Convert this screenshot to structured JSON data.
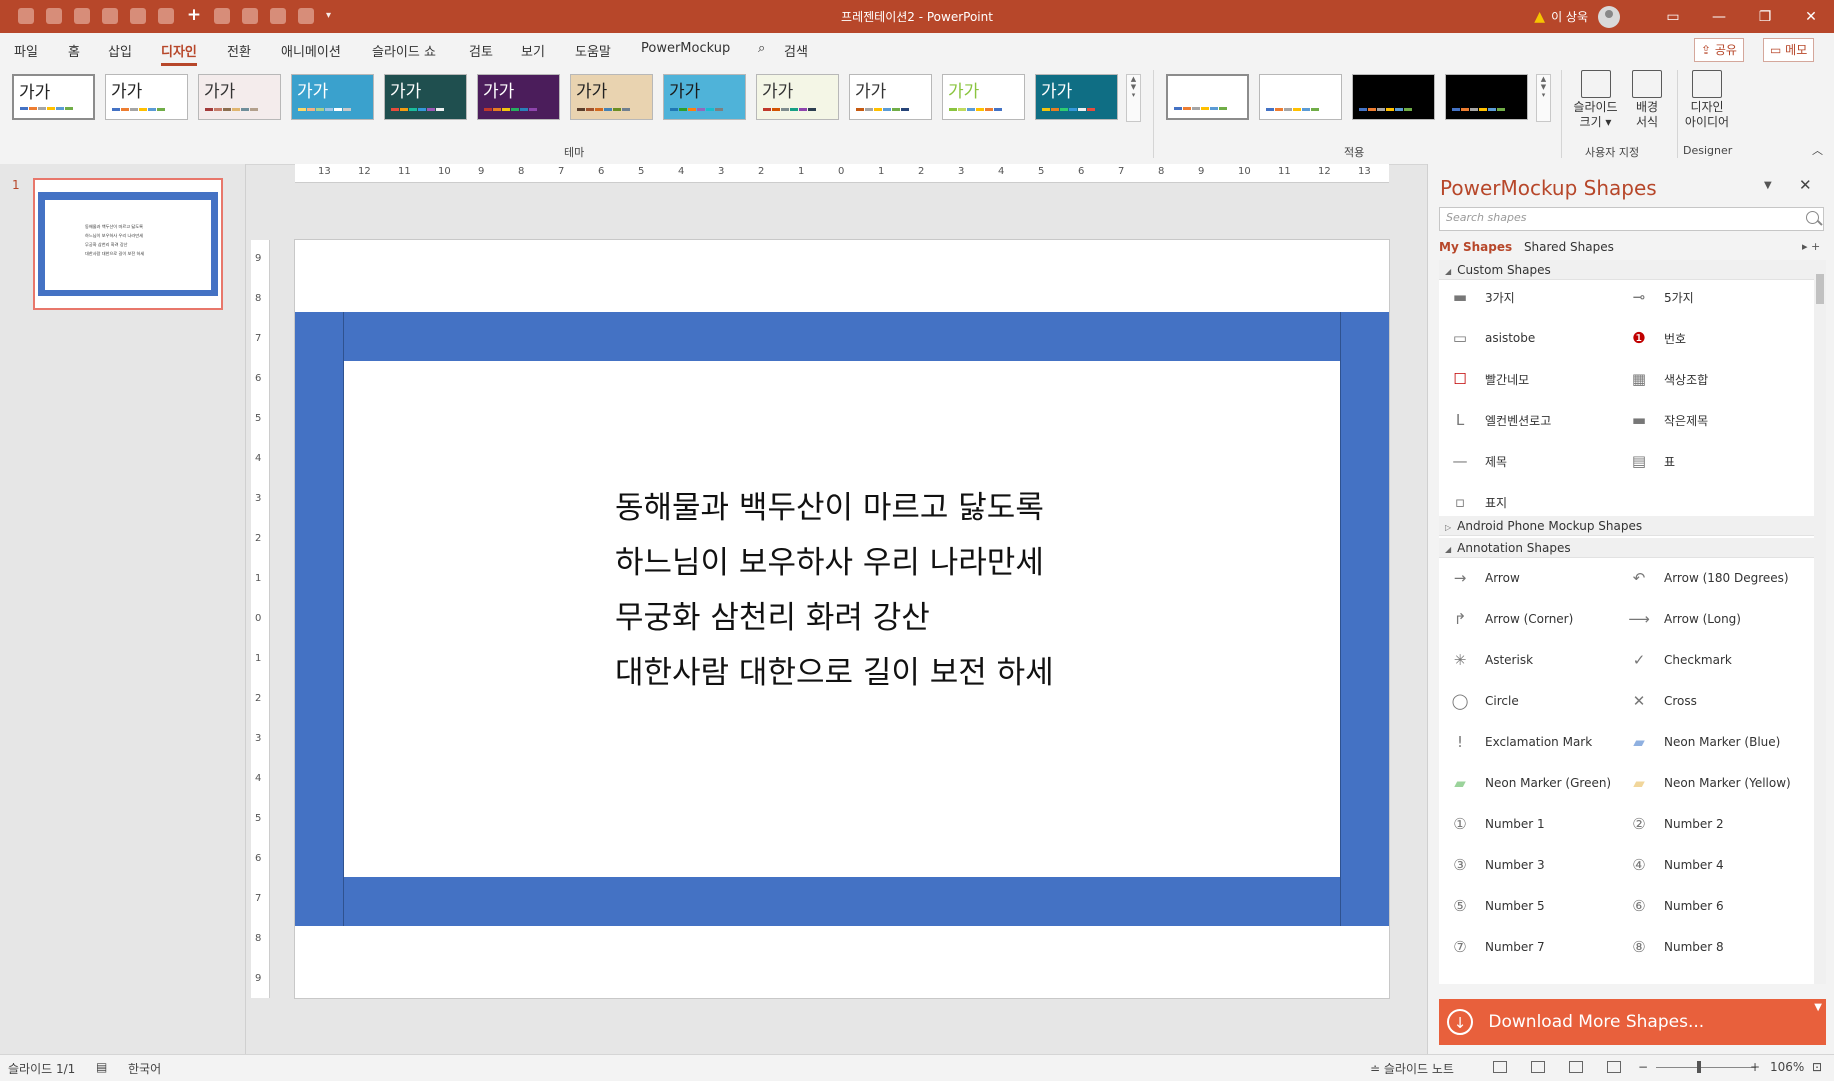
{
  "window": {
    "title": "프레젠테이션2  -  PowerPoint",
    "user": "이 상욱"
  },
  "menu": [
    "파일",
    "홈",
    "삽입",
    "디자인",
    "전환",
    "애니메이션",
    "슬라이드 쇼",
    "검토",
    "보기",
    "도움말",
    "PowerMockup"
  ],
  "menu_active": "디자인",
  "search_label": "검색",
  "share_label": "공유",
  "memo_label": "메모",
  "themes": {
    "sample_text": "가가",
    "items": [
      {
        "bg": "#ffffff",
        "fg": "#222222",
        "bars": [
          "#4472c4",
          "#ed7d31",
          "#a5a5a5",
          "#ffc000",
          "#5b9bd5",
          "#70ad47"
        ]
      },
      {
        "bg": "#ffffff",
        "fg": "#222222",
        "bars": [
          "#4472c4",
          "#ed7d31",
          "#a5a5a5",
          "#ffc000",
          "#5b9bd5",
          "#70ad47"
        ]
      },
      {
        "bg": "#f4ecec",
        "fg": "#333333",
        "bars": [
          "#a33a3a",
          "#c67c6a",
          "#8c6e4f",
          "#e0b56f",
          "#6f8e9a",
          "#b3a08c"
        ]
      },
      {
        "bg": "#3aa1cd",
        "fg": "#ffffff",
        "bars": [
          "#ffd966",
          "#f4b183",
          "#a9d18e",
          "#9dc3e6",
          "#ffffff",
          "#c9c9c9"
        ]
      },
      {
        "bg": "#1f4f4f",
        "fg": "#ffffff",
        "bars": [
          "#e74c3c",
          "#f39c12",
          "#1abc9c",
          "#3498db",
          "#9b59b6",
          "#ecf0f1"
        ]
      },
      {
        "bg": "#4b1d5b",
        "fg": "#ffffff",
        "bars": [
          "#c0392b",
          "#e67e22",
          "#f1c40f",
          "#27ae60",
          "#2980b9",
          "#8e44ad"
        ]
      },
      {
        "bg": "#e9d3b0",
        "fg": "#222222",
        "bars": [
          "#5a3e2b",
          "#a0522d",
          "#d2691e",
          "#4682b4",
          "#6b8e23",
          "#708090"
        ]
      },
      {
        "bg": "#4fb3d9",
        "fg": "#1a1a1a",
        "bars": [
          "#1f77b4",
          "#2ca02c",
          "#ff7f0e",
          "#9467bd",
          "#17becf",
          "#7f7f7f"
        ]
      },
      {
        "bg": "#f4f6e6",
        "fg": "#333333",
        "bars": [
          "#c0392b",
          "#d35400",
          "#7f8c8d",
          "#16a085",
          "#8e44ad",
          "#2c3e50"
        ]
      },
      {
        "bg": "#ffffff",
        "fg": "#333333",
        "bars": [
          "#c55a11",
          "#a5a5a5",
          "#ffc000",
          "#5b9bd5",
          "#70ad47",
          "#264478"
        ]
      },
      {
        "bg": "#ffffff",
        "fg": "#8ac43f",
        "bars": [
          "#8ac43f",
          "#c0db60",
          "#5b9bd5",
          "#ffc000",
          "#ed7d31",
          "#4472c4"
        ]
      },
      {
        "bg": "#0f6e84",
        "fg": "#ffffff",
        "bars": [
          "#f1c40f",
          "#e67e22",
          "#2ecc71",
          "#3498db",
          "#ecf0f1",
          "#e74c3c"
        ]
      }
    ],
    "variants": [
      {
        "bg": "#ffffff",
        "bars": [
          "#4472c4",
          "#ed7d31",
          "#a5a5a5",
          "#ffc000",
          "#5b9bd5",
          "#70ad47"
        ]
      },
      {
        "bg": "#ffffff",
        "bars": [
          "#4472c4",
          "#ed7d31",
          "#a5a5a5",
          "#ffc000",
          "#5b9bd5",
          "#70ad47"
        ]
      },
      {
        "bg": "#000000",
        "bars": [
          "#4472c4",
          "#ed7d31",
          "#a5a5a5",
          "#ffc000",
          "#5b9bd5",
          "#70ad47"
        ]
      },
      {
        "bg": "#000000",
        "bars": [
          "#4472c4",
          "#ed7d31",
          "#a5a5a5",
          "#ffc000",
          "#5b9bd5",
          "#70ad47"
        ]
      }
    ]
  },
  "ribbon": {
    "group_theme": "테마",
    "group_variant": "적용",
    "slide_size": {
      "line1": "슬라이드",
      "line2": "크기 ▾"
    },
    "bg_format": {
      "line1": "배경",
      "line2": "서식"
    },
    "group_custom": "사용자 지정",
    "design_ideas": {
      "line1": "디자인",
      "line2": "아이디어"
    },
    "group_designer": "Designer"
  },
  "thumbnail": {
    "number": "1"
  },
  "rulers": {
    "h_ticks": [
      "13",
      "12",
      "11",
      "10",
      "9",
      "8",
      "7",
      "6",
      "5",
      "4",
      "3",
      "2",
      "1",
      "0",
      "1",
      "2",
      "3",
      "4",
      "5",
      "6",
      "7",
      "8",
      "9",
      "10",
      "11",
      "12",
      "13"
    ],
    "v_ticks": [
      "9",
      "8",
      "7",
      "6",
      "5",
      "4",
      "3",
      "2",
      "1",
      "0",
      "1",
      "2",
      "3",
      "4",
      "5",
      "6",
      "7",
      "8",
      "9"
    ]
  },
  "slide": {
    "lines": [
      "동해물과 백두산이 마르고 닳도록",
      "하느님이 보우하사 우리 나라만세",
      "무궁화 삼천리 화려 강산",
      "대한사람 대한으로 길이 보전 하세"
    ],
    "frame_color": "#4472c4"
  },
  "pane": {
    "title": "PowerMockup Shapes",
    "search_placeholder": "Search shapes",
    "tab_my": "My Shapes",
    "tab_shared": "Shared Shapes",
    "sections": [
      {
        "label": "Custom Shapes",
        "expanded": true
      },
      {
        "label": "Android Phone Mockup Shapes",
        "expanded": false
      },
      {
        "label": "Annotation Shapes",
        "expanded": true
      }
    ],
    "custom": [
      "3가지",
      "5가지",
      "asistobe",
      "번호",
      "빨간네모",
      "색상조합",
      "엘컨벤션로고",
      "작은제목",
      "제목",
      "표",
      "표지"
    ],
    "annotation": [
      "Arrow",
      "Arrow (180 Degrees)",
      "Arrow (Corner)",
      "Arrow (Long)",
      "Asterisk",
      "Checkmark",
      "Circle",
      "Cross",
      "Exclamation Mark",
      "Neon Marker (Blue)",
      "Neon Marker (Green)",
      "Neon Marker (Yellow)",
      "Number 1",
      "Number 2",
      "Number 3",
      "Number 4",
      "Number 5",
      "Number 6",
      "Number 7",
      "Number 8"
    ],
    "download": "Download More Shapes..."
  },
  "status": {
    "slide": "슬라이드 1/1",
    "language": "한국어",
    "notes": "슬라이드 노트",
    "zoom": "106%"
  }
}
